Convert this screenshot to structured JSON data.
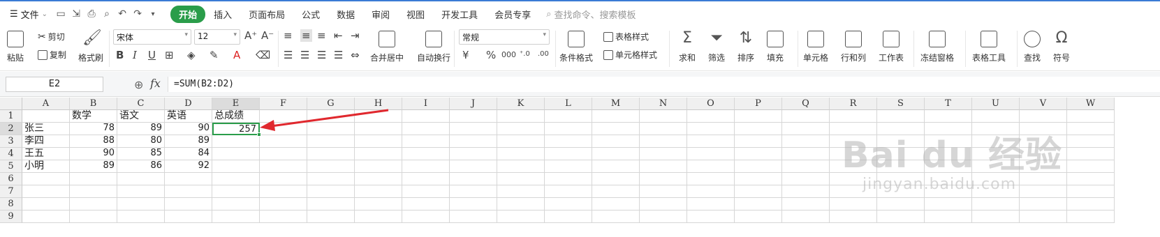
{
  "menubar": {
    "file_label": "文件",
    "tabs": [
      "开始",
      "插入",
      "页面布局",
      "公式",
      "数据",
      "审阅",
      "视图",
      "开发工具",
      "会员专享"
    ],
    "active_tab": "开始",
    "search_placeholder": "查找命令、搜索模板"
  },
  "ribbon": {
    "paste": "粘贴",
    "cut": "剪切",
    "copy": "复制",
    "format_painter": "格式刷",
    "font_name": "宋体",
    "font_size": "12",
    "merge_center": "合并居中",
    "wrap_text": "自动换行",
    "number_format": "常规",
    "conditional_format": "条件格式",
    "table_style": "表格样式",
    "cell_style": "单元格样式",
    "sum": "求和",
    "filter": "筛选",
    "sort": "排序",
    "fill": "填充",
    "cell": "单元格",
    "row_col": "行和列",
    "worksheet": "工作表",
    "freeze": "冻结窗格",
    "table_tools": "表格工具",
    "find": "查找",
    "symbol": "符号"
  },
  "formula_bar": {
    "name_box": "E2",
    "fx": "fx",
    "formula": "=SUM(B2:D2)"
  },
  "sheet": {
    "columns": [
      "A",
      "B",
      "C",
      "D",
      "E",
      "F",
      "G",
      "H",
      "I",
      "J",
      "K",
      "L",
      "M",
      "N",
      "O",
      "P",
      "Q",
      "R",
      "S",
      "T",
      "U",
      "V",
      "W"
    ],
    "rows": [
      "1",
      "2",
      "3",
      "4",
      "5",
      "6",
      "7",
      "8",
      "9"
    ],
    "selected_cell": "E2",
    "cells": {
      "B1": "数学",
      "C1": "语文",
      "D1": "英语",
      "E1": "总成绩",
      "A2": "张三",
      "B2": "78",
      "C2": "89",
      "D2": "90",
      "E2": "257",
      "A3": "李四",
      "B3": "88",
      "C3": "80",
      "D3": "89",
      "A4": "王五",
      "B4": "90",
      "C4": "85",
      "D4": "84",
      "A5": "小明",
      "B5": "89",
      "C5": "86",
      "D5": "92"
    }
  },
  "watermark": {
    "logo_text": "Bai du 经验",
    "url": "jingyan.baidu.com"
  },
  "colors": {
    "accent": "#2a9d4a",
    "arrow": "#e0282e"
  }
}
